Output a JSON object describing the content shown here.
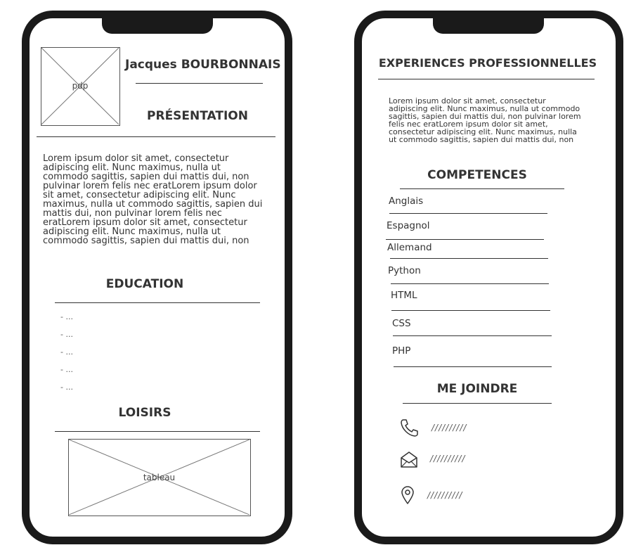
{
  "left_phone": {
    "photo_label": "pdp",
    "name": "Jacques BOURBONNAIS",
    "presentation_title": "PRÉSENTATION",
    "presentation_text": "Lorem ipsum dolor sit amet, consectetur\nadipiscing elit. Nunc maximus, nulla ut\ncommodo sagittis, sapien dui mattis dui, non\npulvinar lorem felis nec eratLorem ipsum dolor\nsit amet, consectetur adipiscing elit. Nunc\nmaximus, nulla ut commodo sagittis, sapien dui\nmattis dui, non pulvinar lorem felis nec\neratLorem ipsum dolor sit amet, consectetur\nadipiscing elit. Nunc maximus, nulla ut\ncommodo sagittis, sapien dui mattis dui, non",
    "education_title": "EDUCATION",
    "education_items": [
      "- ...",
      "- ...",
      "- ...",
      "- ...",
      "- ..."
    ],
    "hobbies_title": "LOISIRS",
    "hobbies_image_label": "tableau"
  },
  "right_phone": {
    "experience_title": "EXPERIENCES PROFESSIONNELLES",
    "experience_text": "Lorem ipsum dolor sit amet, consectetur\nadipiscing elit. Nunc maximus, nulla ut commodo\nsagittis, sapien dui mattis dui, non pulvinar lorem\nfelis nec eratLorem ipsum dolor sit amet,\nconsectetur adipiscing elit. Nunc maximus, nulla\nut commodo sagittis, sapien dui mattis dui, non",
    "skills_title": "COMPETENCES",
    "skills": [
      "Anglais",
      "Espagnol",
      "Allemand",
      "Python",
      "HTML",
      "CSS",
      "PHP"
    ],
    "contact_title": "ME JOINDRE",
    "contacts": [
      {
        "icon": "phone-icon",
        "value": "//////////"
      },
      {
        "icon": "mail-icon",
        "value": "//////////"
      },
      {
        "icon": "location-pin-icon",
        "value": "//////////"
      }
    ]
  }
}
